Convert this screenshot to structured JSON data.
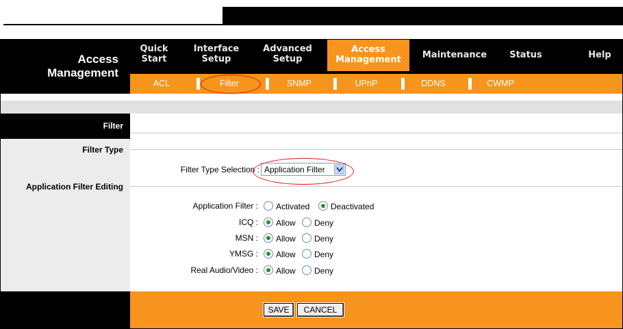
{
  "brand": {
    "line1": "Access",
    "line2": "Management"
  },
  "nav": [
    {
      "line1": "Quick",
      "line2": "Start",
      "active": false
    },
    {
      "line1": "Interface",
      "line2": "Setup",
      "active": false
    },
    {
      "line1": "Advanced",
      "line2": "Setup",
      "active": false
    },
    {
      "line1": "Access",
      "line2": "Management",
      "active": true
    },
    {
      "line1": "Maintenance",
      "line2": "",
      "active": false
    },
    {
      "line1": "Status",
      "line2": "",
      "active": false
    },
    {
      "line1": "Help",
      "line2": "",
      "active": false
    }
  ],
  "subnav": [
    "ACL",
    "Filter",
    "SNMP",
    "UPnP",
    "DDNS",
    "CWMP"
  ],
  "subnav_active": "Filter",
  "left": {
    "section": "Filter",
    "filter_type": "Filter Type",
    "app_filter_editing": "Application Filter Editing"
  },
  "filter_type": {
    "label": "Filter Type Selection :",
    "selected": "Application Filter"
  },
  "app_filter": {
    "label": "Application Filter :",
    "options": [
      "Activated",
      "Deactivated"
    ],
    "selected": "Deactivated"
  },
  "apps": [
    {
      "label": "ICQ :",
      "selected": "Allow"
    },
    {
      "label": "MSN :",
      "selected": "Allow"
    },
    {
      "label": "YMSG :",
      "selected": "Allow"
    },
    {
      "label": "Real Audio/Video :",
      "selected": "Allow"
    }
  ],
  "allow_label": "Allow",
  "deny_label": "Deny",
  "buttons": {
    "save": "SAVE",
    "cancel": "CANCEL"
  },
  "colors": {
    "accent": "#f7941d",
    "header": "#000000",
    "highlight_ring": "#dd1111"
  }
}
